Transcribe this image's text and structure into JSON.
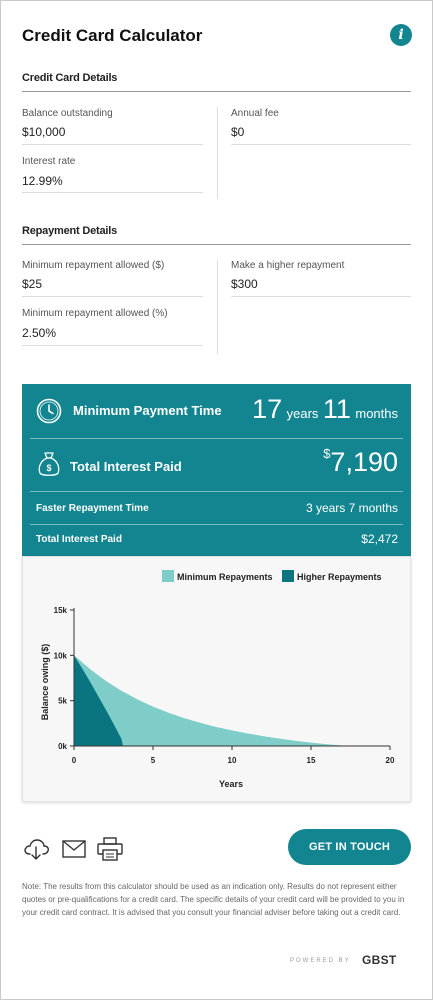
{
  "title": "Credit Card Calculator",
  "icons": {
    "info": "info-icon",
    "clock": "clock-icon",
    "money_bag": "money-bag-icon",
    "download": "cloud-download-icon",
    "email": "envelope-icon",
    "print": "printer-icon"
  },
  "credit_card_details": {
    "heading": "Credit Card Details",
    "balance": {
      "label": "Balance outstanding",
      "value": "$10,000"
    },
    "annual_fee": {
      "label": "Annual fee",
      "value": "$0"
    },
    "interest_rate": {
      "label": "Interest rate",
      "value": "12.99%"
    }
  },
  "repayment_details": {
    "heading": "Repayment Details",
    "min_dollar": {
      "label": "Minimum repayment allowed ($)",
      "value": "$25"
    },
    "higher": {
      "label": "Make a higher repayment",
      "value": "$300"
    },
    "min_percent": {
      "label": "Minimum repayment allowed (%)",
      "value": "2.50%"
    }
  },
  "results": {
    "min_time": {
      "label": "Minimum Payment Time",
      "years": "17",
      "years_unit": "years",
      "months": "11",
      "months_unit": "months"
    },
    "total_interest": {
      "label": "Total Interest Paid",
      "currency": "$",
      "value": "7,190"
    },
    "faster": {
      "label": "Faster Repayment Time",
      "value": "3 years 7 months"
    },
    "total_interest_small": {
      "label": "Total Interest Paid",
      "value": "$2,472"
    }
  },
  "colors": {
    "primary": "#138591",
    "min_series": "#7ecdc8",
    "higher_series": "#0a7580"
  },
  "chart_data": {
    "type": "area",
    "xlabel": "Years",
    "ylabel": "Balance owing ($)",
    "xlim": [
      0,
      20
    ],
    "ylim": [
      0,
      15000
    ],
    "x_ticks": [
      "0",
      "5",
      "10",
      "15",
      "20"
    ],
    "y_ticks": [
      "0k",
      "5k",
      "10k",
      "15k"
    ],
    "legend": "top-right",
    "grid": false,
    "series": [
      {
        "name": "Minimum Repayments",
        "color": "#7ecdc8",
        "x": [
          0,
          1,
          2,
          3,
          4,
          5,
          6,
          7,
          8,
          9,
          10,
          11,
          12,
          13,
          14,
          15,
          16,
          17,
          17.9
        ],
        "y": [
          10000,
          8500,
          7200,
          6100,
          5150,
          4350,
          3650,
          3050,
          2550,
          2100,
          1720,
          1380,
          1080,
          820,
          590,
          380,
          200,
          60,
          0
        ]
      },
      {
        "name": "Higher Repayments",
        "color": "#0a7580",
        "x": [
          0,
          0.5,
          1,
          1.5,
          2,
          2.5,
          3,
          3.1,
          3.6
        ],
        "y": [
          10000,
          8600,
          7150,
          5600,
          4050,
          2450,
          800,
          0,
          0
        ]
      }
    ]
  },
  "actions": {
    "cta": "GET IN TOUCH"
  },
  "note": "Note: The results from this calculator should be used as an indication only. Results do not represent either quotes or pre-qualifications for a credit card. The specific details of your credit card will be provided to you in your credit card contract. It is advised that you consult your financial adviser before taking out a credit card.",
  "footer": {
    "powered_by": "POWERED BY",
    "brand": "GBST"
  }
}
